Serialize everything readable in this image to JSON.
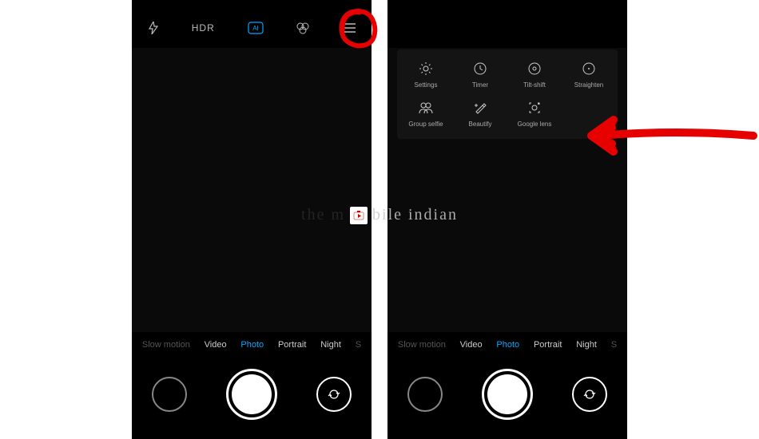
{
  "topbar": {
    "flash": "⚡",
    "hdr": "HDR",
    "ai": "AI",
    "filter": "⊗",
    "menu": "≡"
  },
  "modes": {
    "slowmo": "Slow motion",
    "video": "Video",
    "photo": "Photo",
    "portrait": "Portrait",
    "night": "Night",
    "more": "S"
  },
  "menu": {
    "settings": "Settings",
    "timer": "Timer",
    "tiltshift": "Tilt-shift",
    "straighten": "Straighten",
    "groupselfie": "Group selfie",
    "beautify": "Beautify",
    "googlelens": "Google lens"
  },
  "watermark": {
    "left": "the m",
    "right": "bile indian"
  }
}
